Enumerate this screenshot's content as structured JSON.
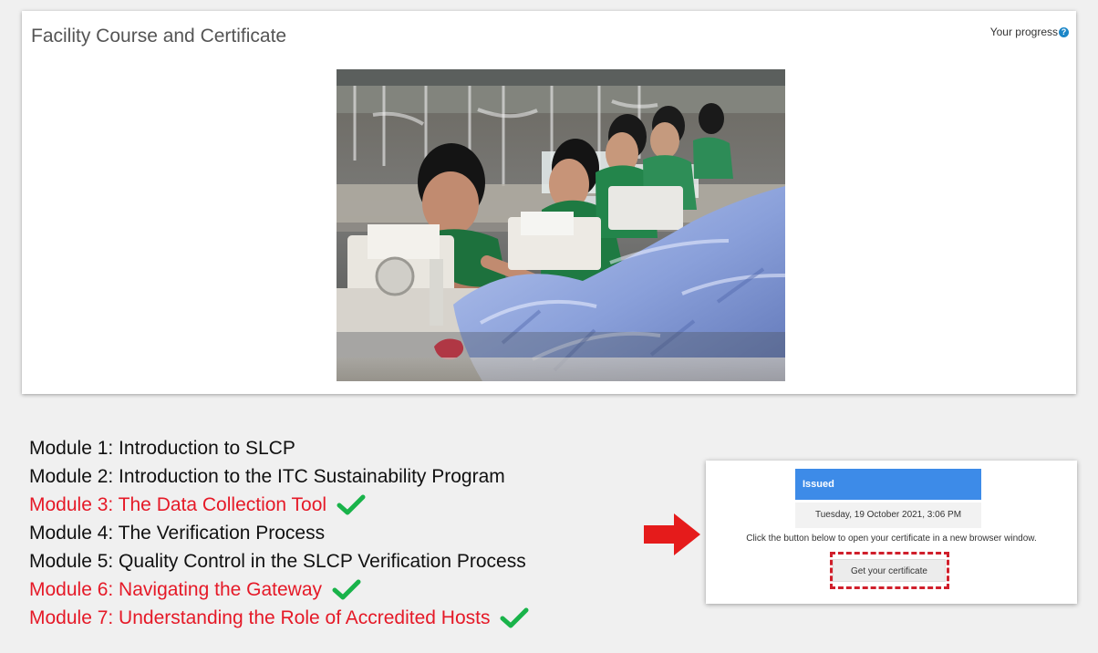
{
  "course": {
    "title": "Facility Course and Certificate",
    "progress_label": "Your progress",
    "help_icon": "question-circle-icon",
    "image_subject": "garment-factory-workers-photo"
  },
  "modules": [
    {
      "label": "Module 1: Introduction to SLCP",
      "completed": false
    },
    {
      "label": "Module 2: Introduction to the ITC Sustainability Program",
      "completed": false
    },
    {
      "label": "Module 3: The Data Collection Tool",
      "completed": true
    },
    {
      "label": "Module 4: The Verification Process",
      "completed": false
    },
    {
      "label": "Module 5: Quality Control in the SLCP Verification Process",
      "completed": false
    },
    {
      "label": "Module 6: Navigating the Gateway",
      "completed": true
    },
    {
      "label": "Module 7: Understanding the Role of Accredited Hosts",
      "completed": true
    }
  ],
  "certificate": {
    "status": "Issued",
    "date": "Tuesday, 19 October 2021, 3:06 PM",
    "instruction": "Click the button below to open your certificate in a new browser window.",
    "button_label": "Get your certificate"
  },
  "icons": {
    "check": "check-icon",
    "arrow": "arrow-right-icon"
  },
  "colors": {
    "completed_text": "#e51927",
    "check": "#19b34a",
    "arrow": "#e51b1b",
    "status_bar": "#3d8be8",
    "dashed_outline": "#d01f2b",
    "help_icon": "#1a86c8"
  }
}
